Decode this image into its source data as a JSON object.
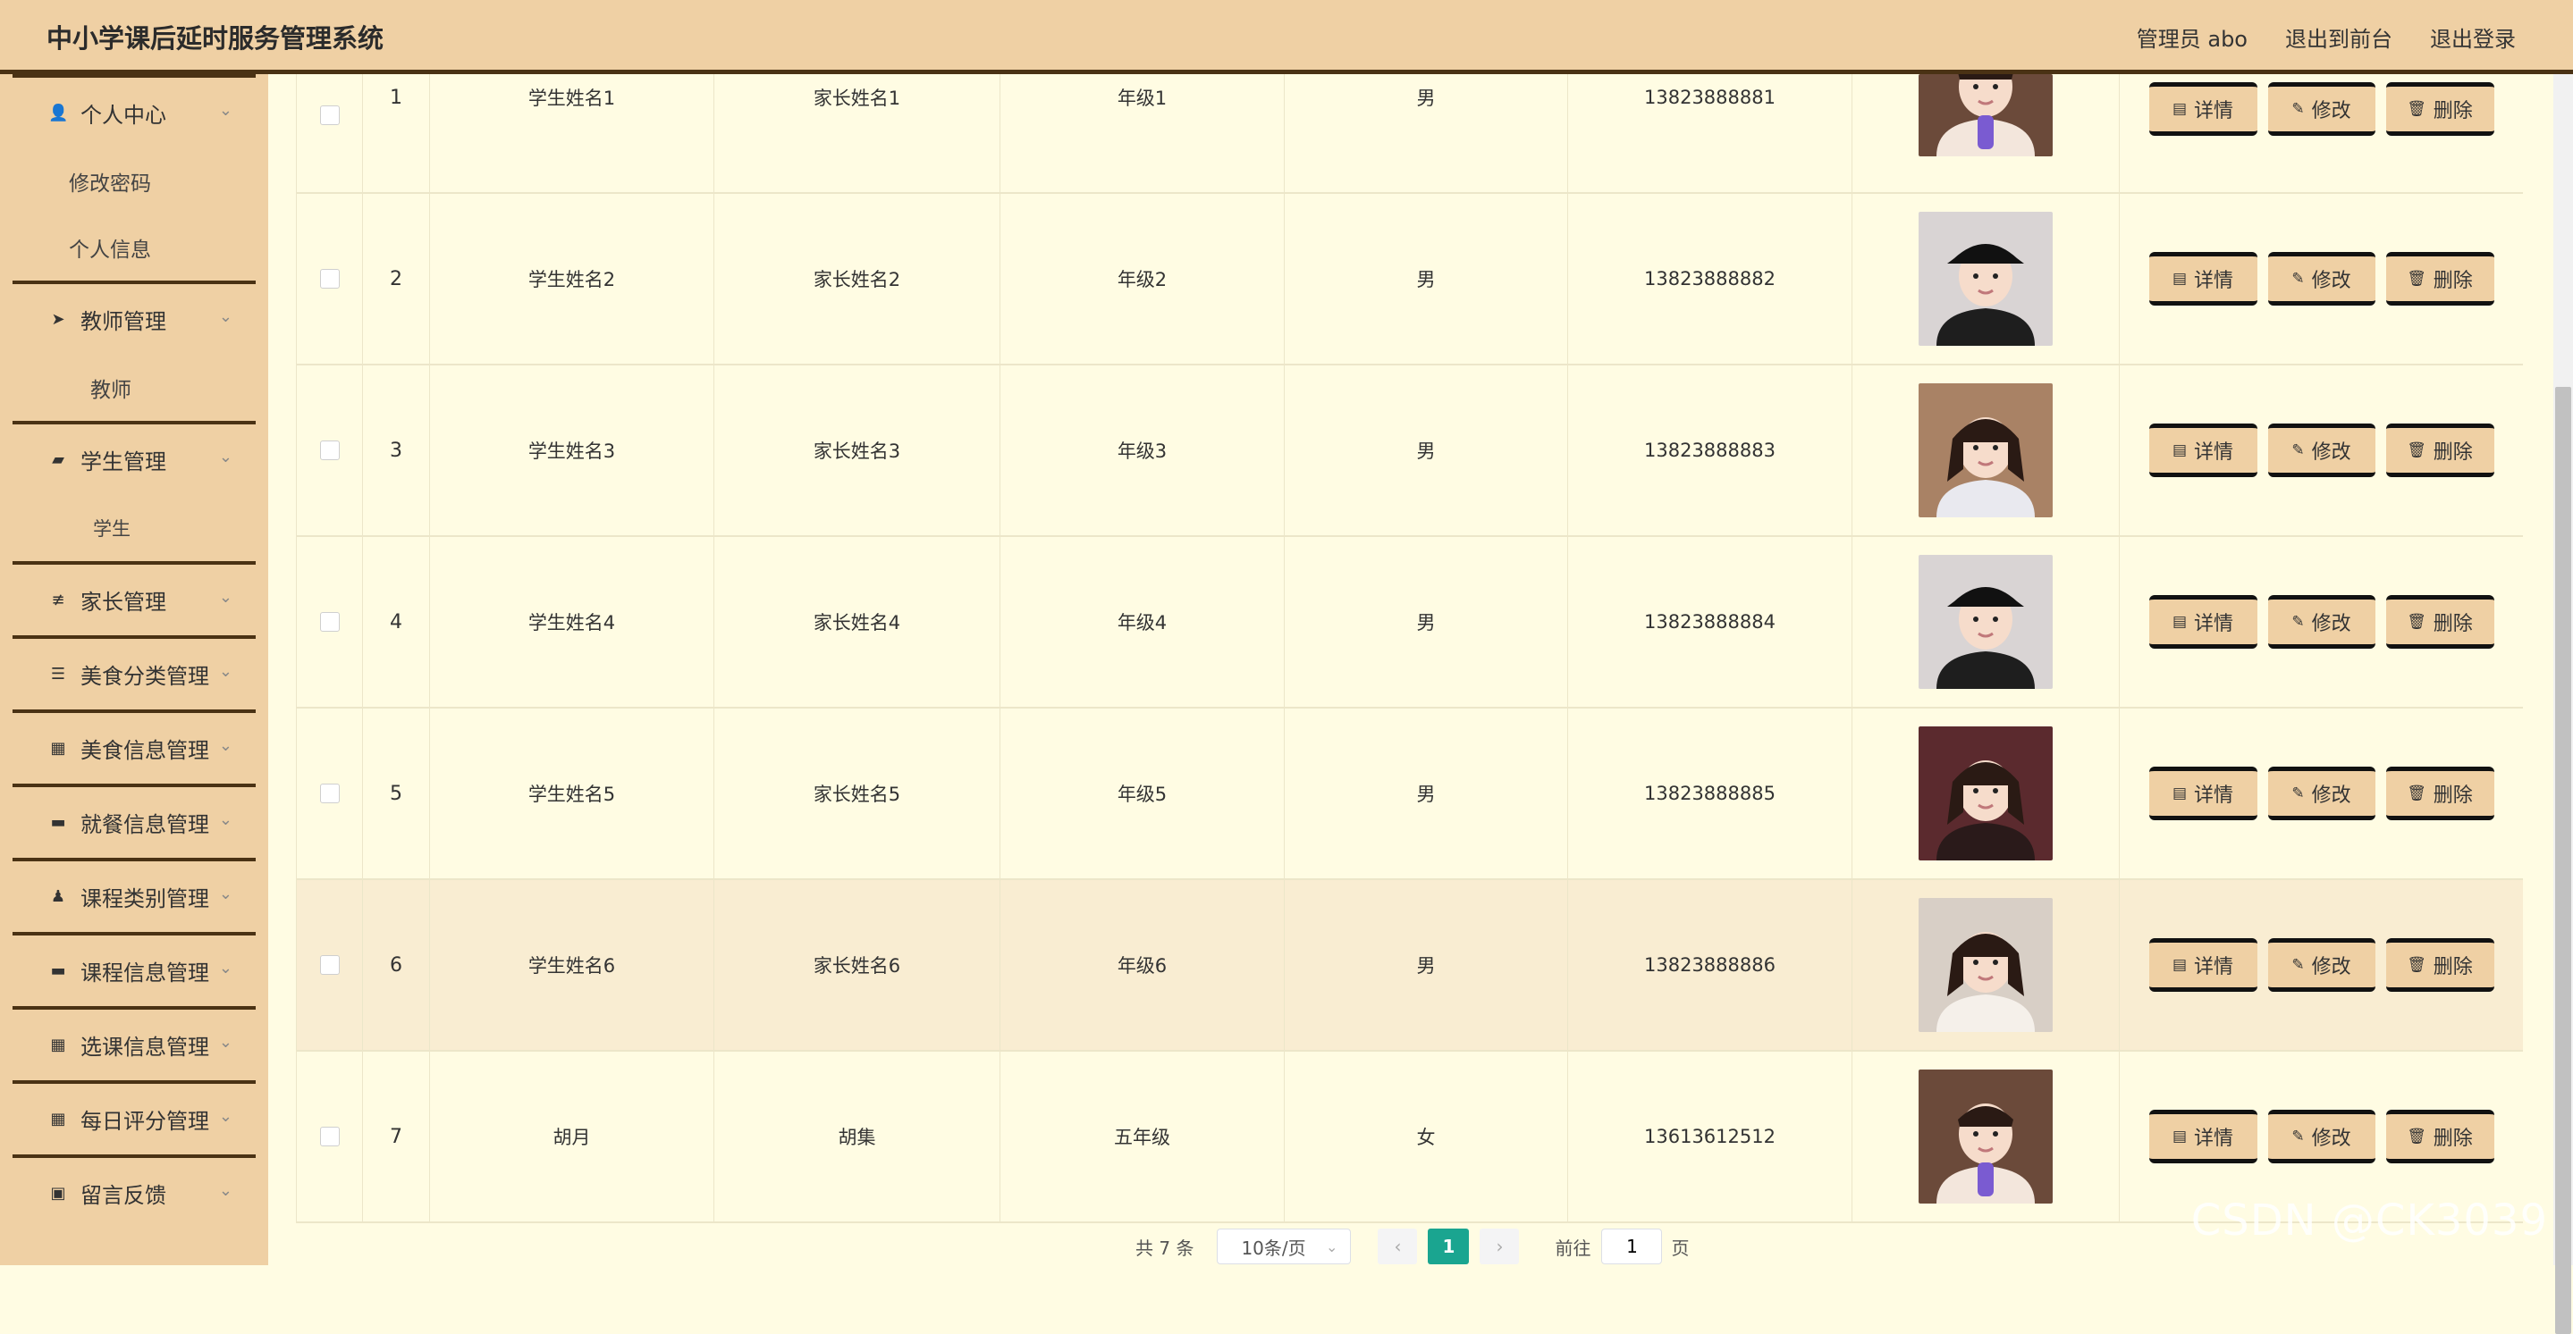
{
  "header": {
    "title": "中小学课后延时服务管理系统",
    "user": "管理员 abo",
    "to_front": "退出到前台",
    "logout": "退出登录"
  },
  "sidebar": {
    "items": [
      {
        "icon": "person-icon",
        "glyph": "👤",
        "label": "个人中心",
        "subs": [
          "修改密码",
          "个人信息"
        ]
      },
      {
        "icon": "send-icon",
        "glyph": "➤",
        "label": "教师管理",
        "subs": [
          "教师"
        ]
      },
      {
        "icon": "ticket-icon",
        "glyph": "▰",
        "label": "学生管理",
        "subs": [
          "学生"
        ]
      },
      {
        "icon": "sliders-icon",
        "glyph": "≢",
        "label": "家长管理"
      },
      {
        "icon": "list-icon",
        "glyph": "☰",
        "label": "美食分类管理"
      },
      {
        "icon": "grid-icon",
        "glyph": "▦",
        "label": "美食信息管理"
      },
      {
        "icon": "monitor-icon",
        "glyph": "▬",
        "label": "就餐信息管理"
      },
      {
        "icon": "user-stamp-icon",
        "glyph": "♟",
        "label": "课程类别管理"
      },
      {
        "icon": "monitor-icon",
        "glyph": "▬",
        "label": "课程信息管理"
      },
      {
        "icon": "grid-icon",
        "glyph": "▦",
        "label": "选课信息管理"
      },
      {
        "icon": "grid-icon",
        "glyph": "▦",
        "label": "每日评分管理"
      },
      {
        "icon": "clipboard-icon",
        "glyph": "▣",
        "label": "留言反馈"
      }
    ]
  },
  "table": {
    "rows": [
      {
        "idx": "1",
        "student": "学生姓名1",
        "parent": "家长姓名1",
        "grade": "年级1",
        "gender": "男",
        "phone": "13823888881",
        "photo": "boy-bottle"
      },
      {
        "idx": "2",
        "student": "学生姓名2",
        "parent": "家长姓名2",
        "grade": "年级2",
        "gender": "男",
        "phone": "13823888882",
        "photo": "boy-cap"
      },
      {
        "idx": "3",
        "student": "学生姓名3",
        "parent": "家长姓名3",
        "grade": "年级3",
        "gender": "男",
        "phone": "13823888883",
        "photo": "girl-dress"
      },
      {
        "idx": "4",
        "student": "学生姓名4",
        "parent": "家长姓名4",
        "grade": "年级4",
        "gender": "男",
        "phone": "13823888884",
        "photo": "boy-cap"
      },
      {
        "idx": "5",
        "student": "学生姓名5",
        "parent": "家长姓名5",
        "grade": "年级5",
        "gender": "男",
        "phone": "13823888885",
        "photo": "girl-drink"
      },
      {
        "idx": "6",
        "student": "学生姓名6",
        "parent": "家长姓名6",
        "grade": "年级6",
        "gender": "男",
        "phone": "13823888886",
        "photo": "girl-laugh"
      },
      {
        "idx": "7",
        "student": "胡月",
        "parent": "胡集",
        "grade": "五年级",
        "gender": "女",
        "phone": "13613612512",
        "photo": "boy-bottle"
      }
    ],
    "actions": {
      "detail": "详情",
      "edit": "修改",
      "delete": "删除"
    },
    "highlight_row": 6
  },
  "pagination": {
    "total": "共 7 条",
    "page_size": "10条/页",
    "current_page": "1",
    "goto_label": "前往",
    "goto_value": "1",
    "page_suffix": "页"
  },
  "watermark": "CSDN @CK3039",
  "colors": {
    "header_bg": "#efd0a4",
    "table_bg": "#fffce3",
    "accent": "#1aa590",
    "border_dark": "#4a3214"
  }
}
